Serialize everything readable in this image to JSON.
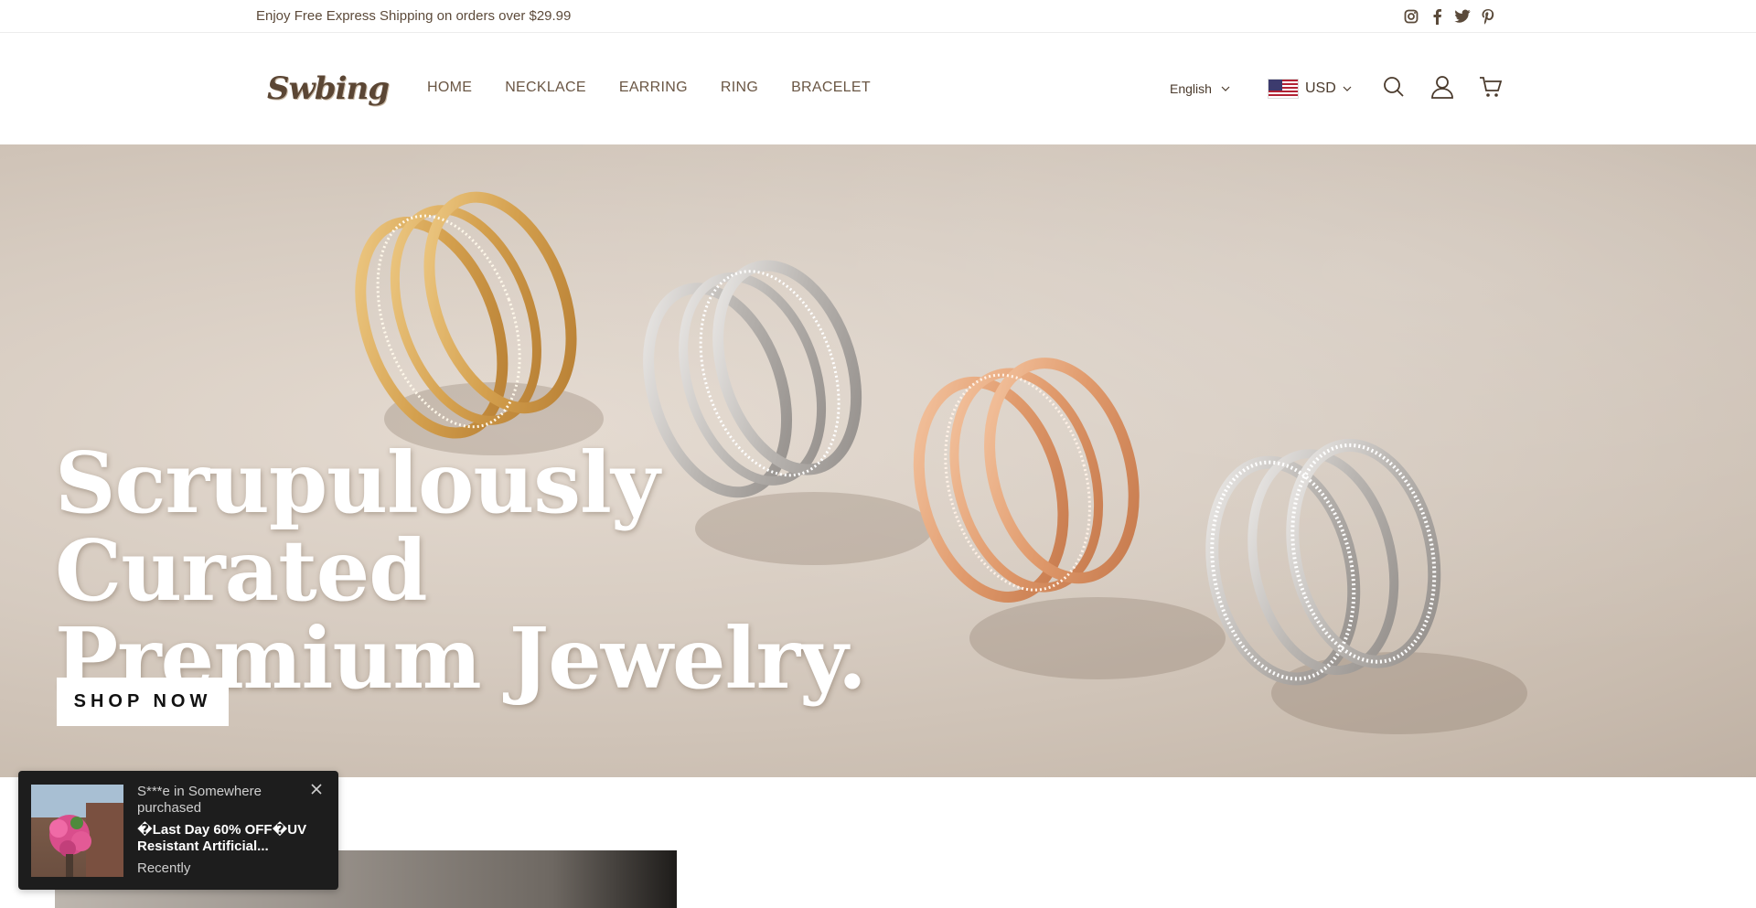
{
  "announcement": {
    "text": "Enjoy Free Express Shipping on orders over $29.99"
  },
  "social": [
    {
      "icon": "instagram-icon"
    },
    {
      "icon": "facebook-icon"
    },
    {
      "icon": "twitter-icon"
    },
    {
      "icon": "pinterest-icon"
    }
  ],
  "header": {
    "logo": "Swbing",
    "nav": [
      "HOME",
      "NECKLACE",
      "EARRING",
      "RING",
      "BRACELET"
    ],
    "language": "English",
    "currency": "USD",
    "icons": [
      "search-icon",
      "account-icon",
      "cart-icon"
    ]
  },
  "hero": {
    "title_line1": "Scrupulously Curated",
    "title_line2": "Premium Jewelry.",
    "cta": "SHOP NOW"
  },
  "popup": {
    "line1": "S***e in Somewhere purchased",
    "product": "�Last Day 60% OFF�UV Resistant Artificial...",
    "time": "Recently"
  },
  "colors": {
    "text_brown": "#5a4a3a",
    "popup_bg": "#1d1d1d",
    "hero_bg": "#d6cbc0"
  }
}
